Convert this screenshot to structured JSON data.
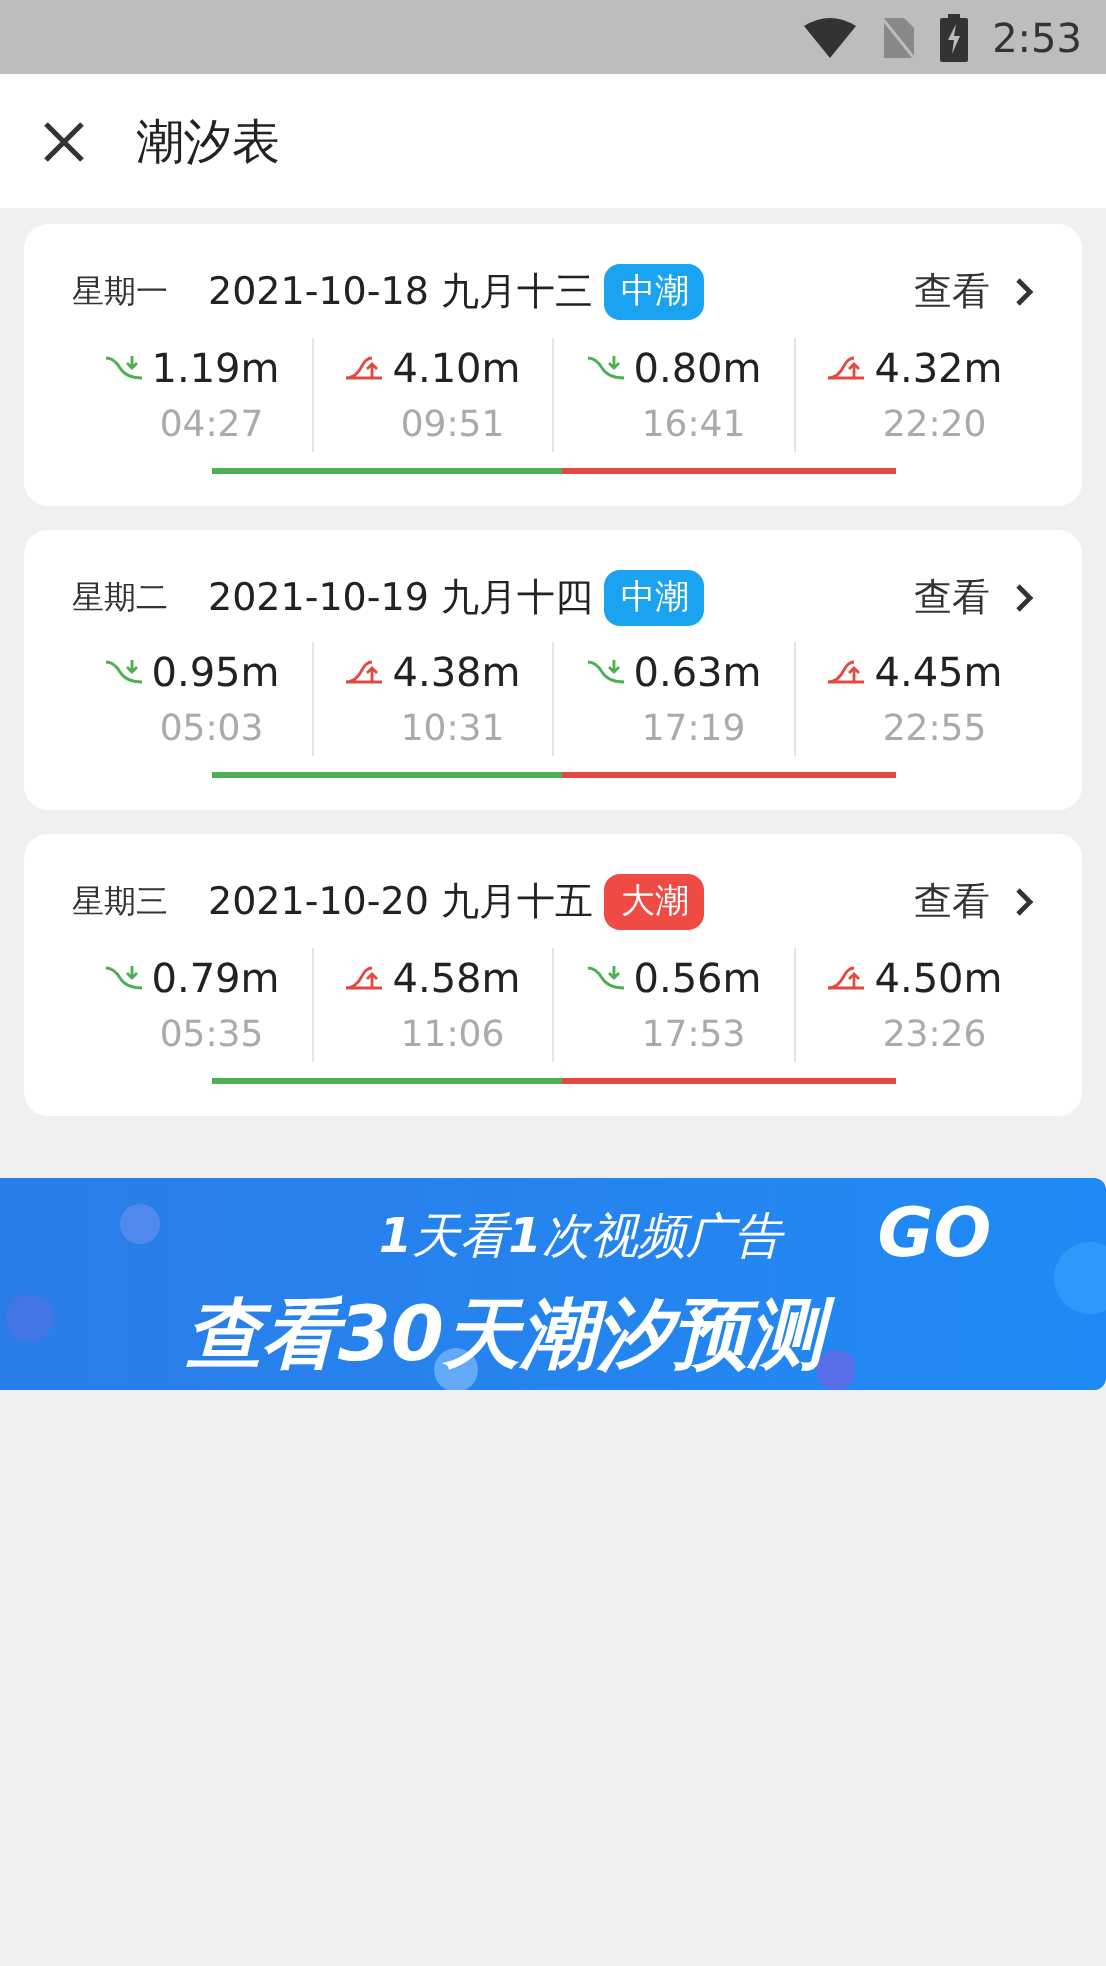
{
  "status_bar": {
    "time": "2:53"
  },
  "header": {
    "title": "潮汐表"
  },
  "days": [
    {
      "weekday": "星期一",
      "date": "2021-10-18 九月十三",
      "tide_type": {
        "label": "中潮",
        "color": "#1aa3f0"
      },
      "view": "查看",
      "tides": [
        {
          "kind": "low",
          "height": "1.19m",
          "time": "04:27"
        },
        {
          "kind": "high",
          "height": "4.10m",
          "time": "09:51"
        },
        {
          "kind": "low",
          "height": "0.80m",
          "time": "16:41"
        },
        {
          "kind": "high",
          "height": "4.32m",
          "time": "22:20"
        }
      ]
    },
    {
      "weekday": "星期二",
      "date": "2021-10-19 九月十四",
      "tide_type": {
        "label": "中潮",
        "color": "#1aa3f0"
      },
      "view": "查看",
      "tides": [
        {
          "kind": "low",
          "height": "0.95m",
          "time": "05:03"
        },
        {
          "kind": "high",
          "height": "4.38m",
          "time": "10:31"
        },
        {
          "kind": "low",
          "height": "0.63m",
          "time": "17:19"
        },
        {
          "kind": "high",
          "height": "4.45m",
          "time": "22:55"
        }
      ]
    },
    {
      "weekday": "星期三",
      "date": "2021-10-20 九月十五",
      "tide_type": {
        "label": "大潮",
        "color": "#f04a45"
      },
      "view": "查看",
      "tides": [
        {
          "kind": "low",
          "height": "0.79m",
          "time": "05:35"
        },
        {
          "kind": "high",
          "height": "4.58m",
          "time": "11:06"
        },
        {
          "kind": "low",
          "height": "0.56m",
          "time": "17:53"
        },
        {
          "kind": "high",
          "height": "4.50m",
          "time": "23:26"
        }
      ]
    }
  ],
  "banner": {
    "line_1": "**1**天看**1**次视频广告",
    "go": "GO",
    "line_2": "查看30天潮汐预测"
  }
}
